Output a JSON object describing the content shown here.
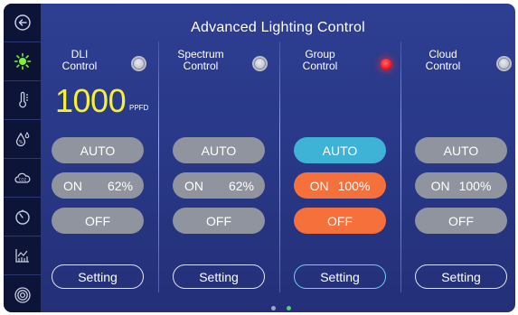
{
  "title": "Advanced Lighting  Control",
  "sidebar": {
    "items": [
      {
        "icon": "back-arrow-icon"
      },
      {
        "icon": "sun-icon",
        "active": true,
        "color": "#7cf23a"
      },
      {
        "icon": "thermometer-icon"
      },
      {
        "icon": "humidity-drops-icon"
      },
      {
        "icon": "co2-cloud-icon"
      },
      {
        "icon": "timer-icon"
      },
      {
        "icon": "chart-icon"
      },
      {
        "icon": "target-icon"
      }
    ]
  },
  "columns": [
    {
      "title_line1": "DLI",
      "title_line2": "Control",
      "indicator": "off",
      "dli_value": "1000",
      "dli_unit": "PPFD",
      "auto_label": "AUTO",
      "on_label": "ON",
      "on_value": "62%",
      "off_label": "OFF",
      "setting_label": "Setting"
    },
    {
      "title_line1": "Spectrum",
      "title_line2": "Control",
      "indicator": "off",
      "auto_label": "AUTO",
      "on_label": "ON",
      "on_value": "62%",
      "off_label": "OFF",
      "setting_label": "Setting"
    },
    {
      "title_line1": "Group",
      "title_line2": "Control",
      "indicator": "on-red",
      "auto_label": "AUTO",
      "on_label": "ON",
      "on_value": "100%",
      "off_label": "OFF",
      "setting_label": "Setting"
    },
    {
      "title_line1": "Cloud",
      "title_line2": "Control",
      "indicator": "off",
      "auto_label": "AUTO",
      "on_label": "ON",
      "on_value": "100%",
      "off_label": "OFF",
      "setting_label": "Setting"
    }
  ],
  "pagination": {
    "pages": 2,
    "current": 2
  },
  "colors": {
    "background": "#2b3a8c",
    "sidebar": "#0c1438",
    "pill_gray": "#8f949e",
    "pill_blue": "#3fb3d6",
    "pill_orange": "#f5703a",
    "dli_value": "#f5f234",
    "indicator_red": "#ff1f1f",
    "page_dot_active": "#4ed36a",
    "page_dot_inactive": "#9aa3c8"
  }
}
